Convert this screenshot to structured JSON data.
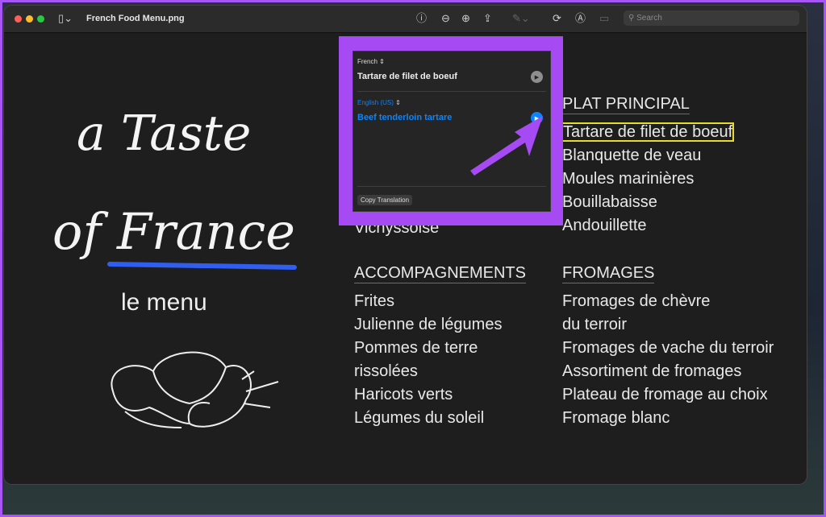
{
  "window": {
    "title": "French Food Menu.png",
    "search_placeholder": "Search"
  },
  "menu": {
    "logo_text": "a Taste of France",
    "subtitle": "le menu",
    "left_column_visible_item": "Vichyssoise",
    "plat_principal": {
      "heading": "PLAT PRINCIPAL",
      "items": [
        "Tartare de filet de boeuf",
        "Blanquette de veau",
        "Moules marinières",
        "Bouillabaisse",
        "Andouillette"
      ]
    },
    "accompagnements": {
      "heading": "ACCOMPAGNEMENTS",
      "items": [
        "Frites",
        "Julienne de légumes",
        "Pommes de terre",
        "rissolées",
        "Haricots verts",
        "Légumes du soleil"
      ]
    },
    "fromages": {
      "heading": "FROMAGES",
      "items": [
        "Fromages de chèvre",
        "du terroir",
        "Fromages de vache du terroir",
        "Assortiment de fromages",
        "Plateau de fromage au choix",
        "Fromage blanc"
      ]
    }
  },
  "translation": {
    "source_language": "French",
    "source_text": "Tartare de filet de boeuf",
    "target_language": "English (US)",
    "target_text": "Beef tenderloin tartare",
    "copy_label": "Copy Translation"
  },
  "colors": {
    "accent": "#0a84ff",
    "highlight": "#a855f7",
    "selection": "#e8dc2a"
  }
}
